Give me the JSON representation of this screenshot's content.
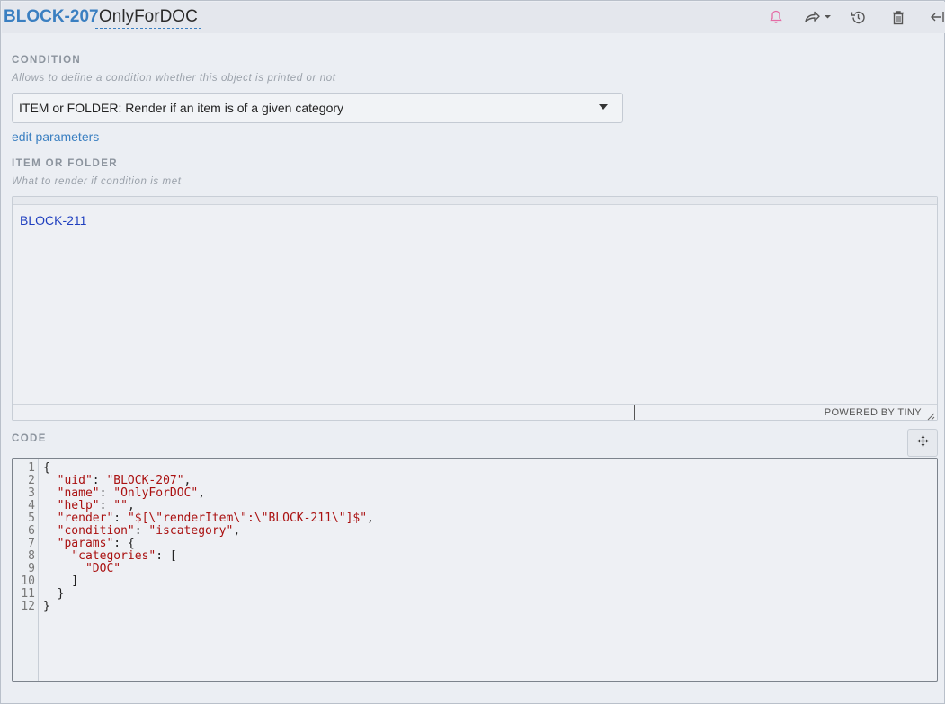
{
  "header": {
    "block_id": "BLOCK-207",
    "block_name": "OnlyForDOC",
    "icons": [
      "bell-icon",
      "share-icon",
      "history-icon",
      "trash-icon",
      "collapse-icon"
    ],
    "accent": "#3a7fc1",
    "bell_color": "#e46ba5"
  },
  "condition": {
    "title": "CONDITION",
    "help": "Allows to define a condition whether this object is printed or not",
    "selected": "ITEM or FOLDER: Render if an item is of a given category",
    "edit_link": "edit parameters"
  },
  "item_or_folder": {
    "title": "ITEM OR FOLDER",
    "help": "What to render if condition is met",
    "content": "BLOCK-211",
    "powered_by": "POWERED BY TINY"
  },
  "code": {
    "title": "CODE",
    "line_numbers": [
      "1",
      "2",
      "3",
      "4",
      "5",
      "6",
      "7",
      "8",
      "9",
      "10",
      "11",
      "12"
    ],
    "lines": [
      "{",
      "  \"uid\": \"BLOCK-207\",",
      "  \"name\": \"OnlyForDOC\",",
      "  \"help\": \"\",",
      "  \"render\": \"$[\\\"renderItem\\\":\\\"BLOCK-211\\\"]$\",",
      "  \"condition\": \"iscategory\",",
      "  \"params\": {",
      "    \"categories\": [",
      "      \"DOC\"",
      "    ]",
      "  }",
      "}"
    ]
  }
}
